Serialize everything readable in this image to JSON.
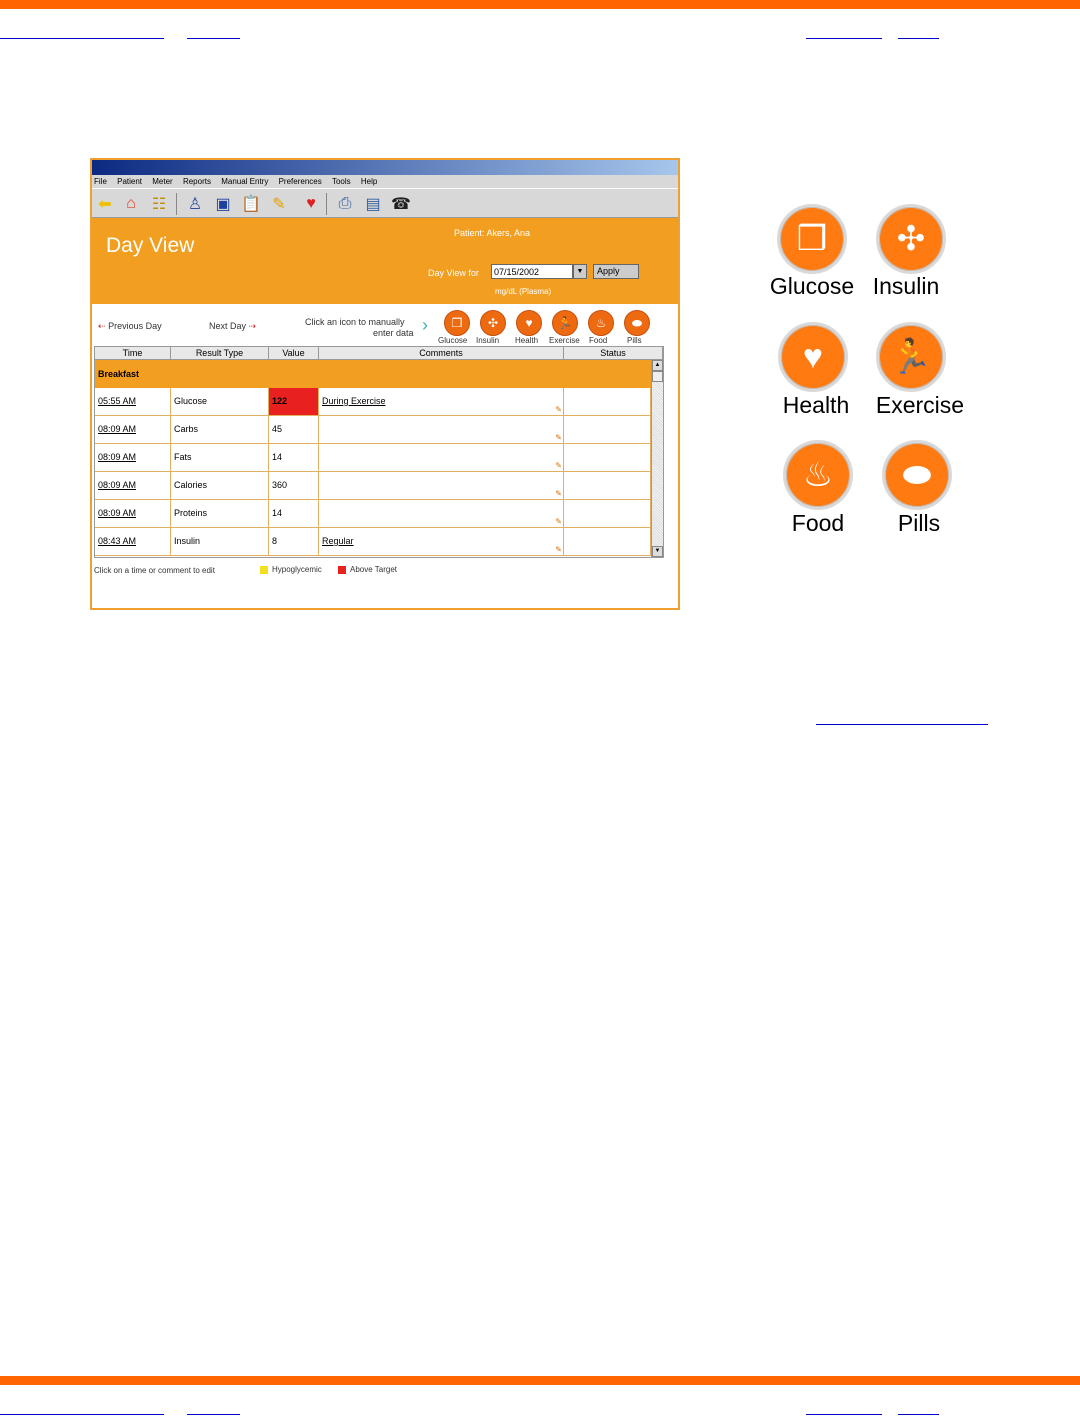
{
  "app": {
    "menu": [
      "File",
      "Patient",
      "Meter",
      "Reports",
      "Manual Entry",
      "Preferences",
      "Tools",
      "Help"
    ],
    "title": "Day View",
    "patient": "Patient: Akers, Ana",
    "dayview_label": "Day View for",
    "date_value": "07/15/2002",
    "apply_label": "Apply",
    "units": "mg/dL (Plasma)",
    "prev_day": "Previous Day",
    "next_day": "Next Day",
    "click_hint_1": "Click an icon to manually",
    "click_hint_2": "enter data",
    "mini_icons": [
      "Glucose",
      "Insulin",
      "Health",
      "Exercise",
      "Food",
      "Pills"
    ],
    "columns": [
      "Time",
      "Result Type",
      "Value",
      "Comments",
      "Status"
    ],
    "section": "Breakfast",
    "rows": [
      {
        "time": "05:55 AM",
        "type": "Glucose",
        "value": "122",
        "comment": "During Exercise",
        "highlight": "#e82020"
      },
      {
        "time": "08:09 AM",
        "type": "Carbs",
        "value": "45",
        "comment": ""
      },
      {
        "time": "08:09 AM",
        "type": "Fats",
        "value": "14",
        "comment": ""
      },
      {
        "time": "08:09 AM",
        "type": "Calories",
        "value": "360",
        "comment": ""
      },
      {
        "time": "08:09 AM",
        "type": "Proteins",
        "value": "14",
        "comment": ""
      },
      {
        "time": "08:43 AM",
        "type": "Insulin",
        "value": "8",
        "comment": "Regular"
      }
    ],
    "footer_note": "Click on a time or comment to edit",
    "legend": [
      {
        "label": "Hypoglycemic",
        "color": "#f0e020"
      },
      {
        "label": "Above Target",
        "color": "#e82020"
      }
    ]
  },
  "big_icons": [
    "Glucose",
    "Insulin",
    "Health",
    "Exercise",
    "Food",
    "Pills"
  ],
  "colors": {
    "brand": "#ff6600",
    "header": "#f29e20",
    "link": "#0000cc"
  }
}
